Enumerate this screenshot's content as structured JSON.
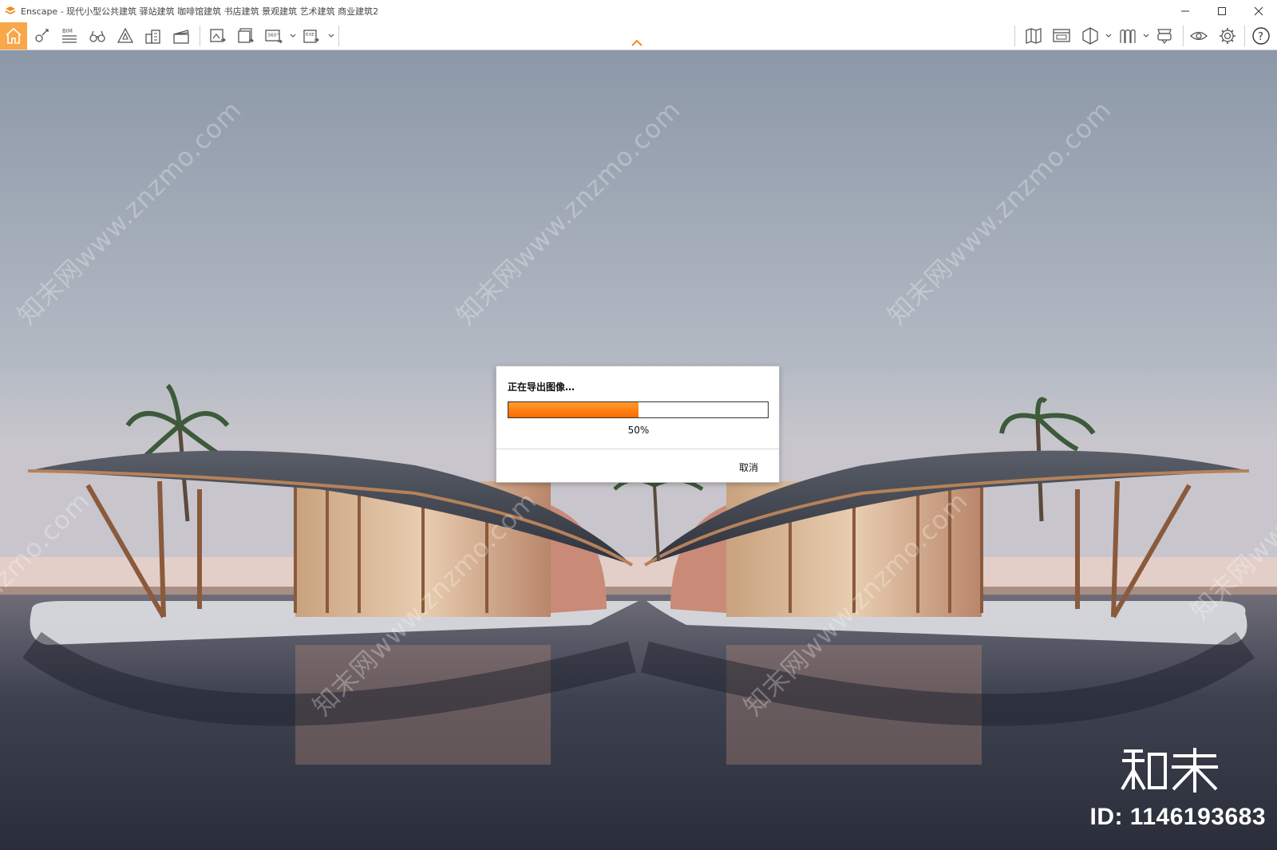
{
  "window": {
    "title": "Enscape - 现代小型公共建筑 驿站建筑 咖啡馆建筑 书店建筑 景观建筑 艺术建筑 商业建筑2",
    "controls": [
      "minimize-icon",
      "maximize-icon",
      "close-icon"
    ]
  },
  "toolbar": {
    "left_icons": [
      "home-icon",
      "pin-views-icon",
      "bim-icon",
      "binoculars-icon",
      "asset-library-icon",
      "buildings-icon",
      "clapperboard-icon",
      "screenshot-icon",
      "batch-render-icon",
      "panorama-360-icon",
      "export-exe-icon"
    ],
    "bim_label": "BIM",
    "pano_label": "360°",
    "exe_label": "EXE",
    "right_icons": [
      "map-icon",
      "web-standalone-icon",
      "cube-icon",
      "collaboration-icon",
      "vr-headset-icon",
      "eye-icon",
      "settings-gear-icon",
      "help-icon"
    ],
    "help_label": "?",
    "accent": "#f9a74b"
  },
  "dialog": {
    "title": "正在导出图像…",
    "progress": 0.5,
    "percent_label": "50%",
    "cancel_label": "取消",
    "progress_color": "#ff7a10"
  },
  "watermark": {
    "diagonal_text": "知末网www.znzmo.com",
    "brand": "知末",
    "id_label": "ID: 1146193683"
  }
}
